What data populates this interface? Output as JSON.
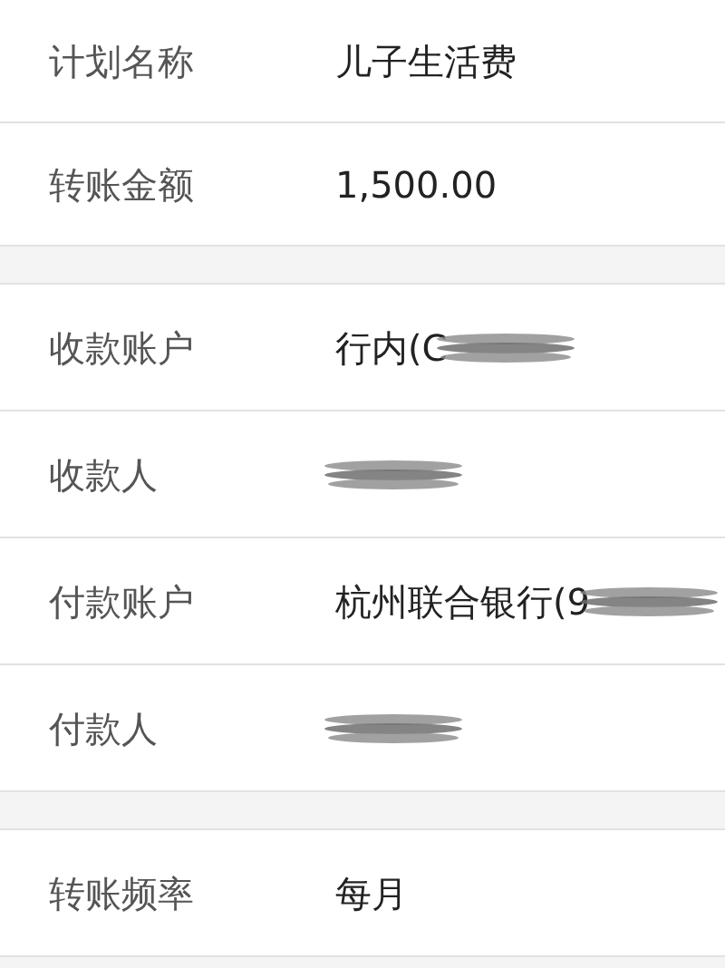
{
  "groups": [
    {
      "rows": [
        {
          "label": "计划名称",
          "value": "儿子生活费",
          "redacted": false
        },
        {
          "label": "转账金额",
          "value": "1,500.00",
          "redacted": false
        }
      ]
    },
    {
      "rows": [
        {
          "label": "收款账户",
          "value": "行内(C",
          "redacted": true
        },
        {
          "label": "收款人",
          "redacted": true
        },
        {
          "label": "付款账户",
          "value": "杭州联合银行(9",
          "redacted": true
        },
        {
          "label": "付款人",
          "redacted": true
        }
      ]
    },
    {
      "rows": [
        {
          "label": "转账频率",
          "value": "每月",
          "redacted": false
        }
      ]
    }
  ]
}
